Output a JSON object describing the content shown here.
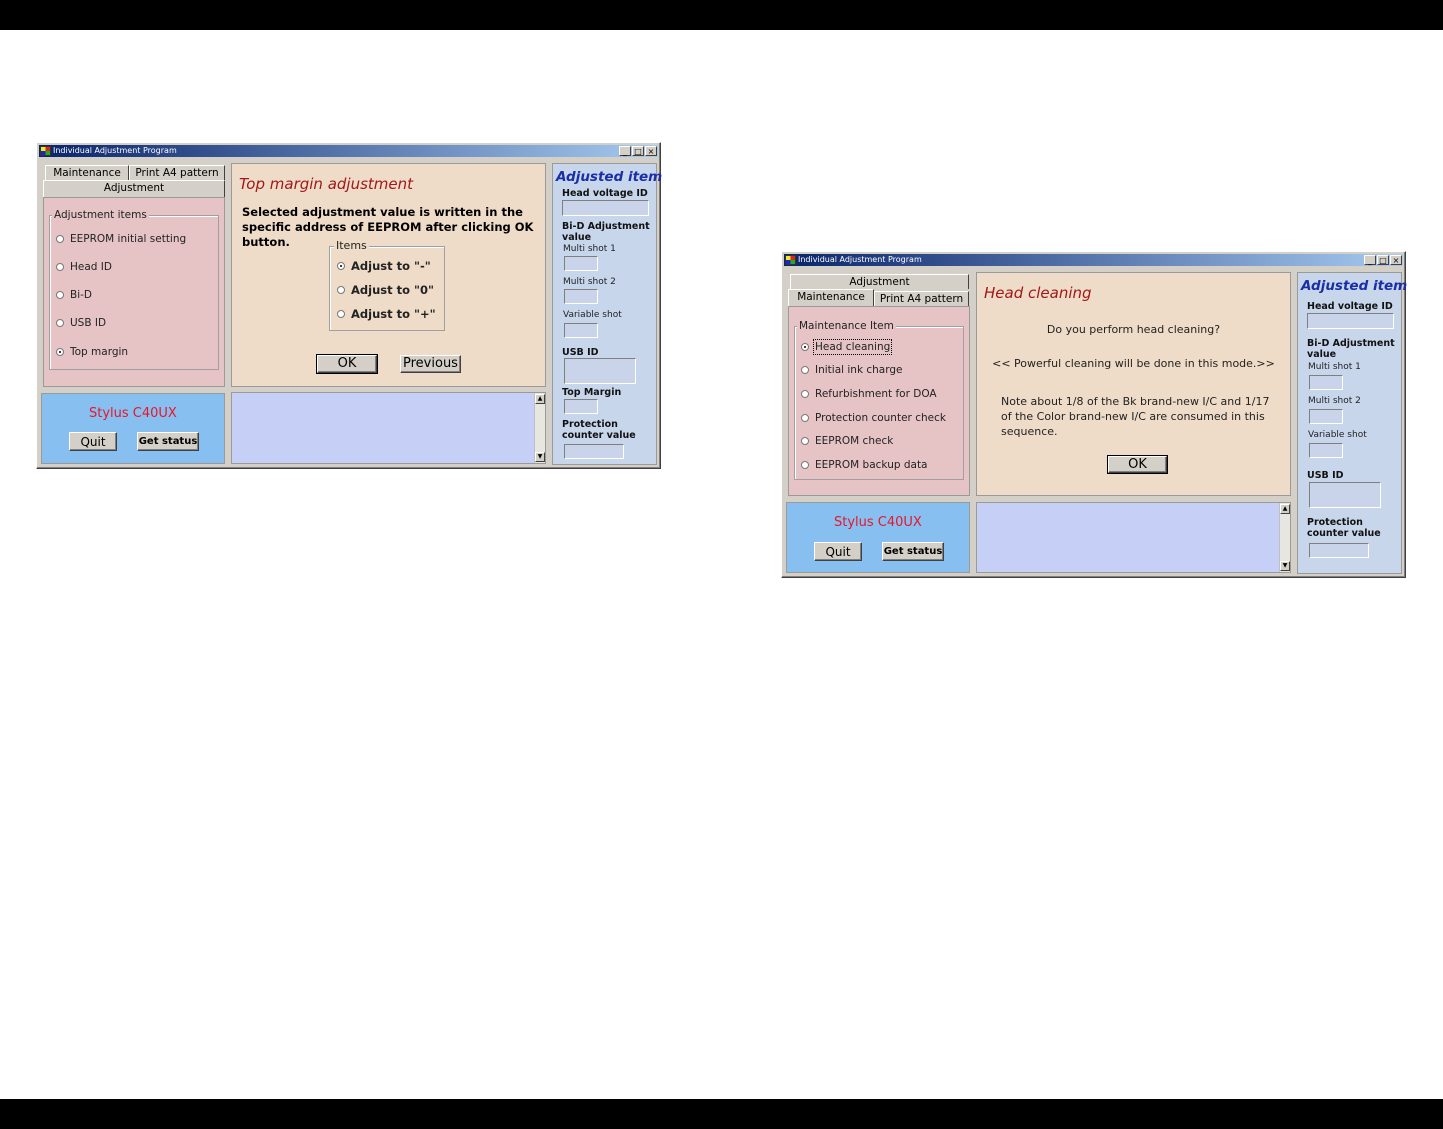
{
  "colors": {
    "page_bar": "#000000",
    "heading_red": "#a01818",
    "model_red": "#e8162a",
    "adjusted_blue": "#1a2ea8"
  },
  "window_left": {
    "title": "Individual Adjustment Program",
    "title_buttons": [
      "_",
      "□",
      "×"
    ],
    "tabs": {
      "maintenance": "Maintenance",
      "print_a4": "Print A4 pattern",
      "adjustment": "Adjustment"
    },
    "group_label": "Adjustment items",
    "items": [
      {
        "label": "EEPROM initial setting",
        "selected": false
      },
      {
        "label": "Head ID",
        "selected": false
      },
      {
        "label": "Bi-D",
        "selected": false
      },
      {
        "label": "USB ID",
        "selected": false
      },
      {
        "label": "Top margin",
        "selected": true
      }
    ],
    "heading": "Top margin adjustment",
    "description": "Selected adjustment value is written in the specific address of EEPROM after clicking OK button.",
    "items_group_label": "Items",
    "adjust_options": [
      {
        "label": "Adjust to \"-\"",
        "selected": true
      },
      {
        "label": "Adjust to \"0\"",
        "selected": false
      },
      {
        "label": "Adjust to \"+\"",
        "selected": false
      }
    ],
    "ok_label": "OK",
    "previous_label": "Previous",
    "model": "Stylus C40UX",
    "quit_label": "Quit",
    "get_status_label": "Get status",
    "adjusted": {
      "title": "Adjusted item",
      "head_voltage": "Head voltage ID",
      "bid": "Bi-D Adjustment value",
      "multi1": "Multi shot 1",
      "multi2": "Multi shot 2",
      "variable": "Variable shot",
      "usb": "USB ID",
      "top_margin": "Top Margin",
      "protection": "Protection counter value"
    }
  },
  "window_right": {
    "title": "Individual Adjustment Program",
    "title_buttons": [
      "_",
      "□",
      "×"
    ],
    "tabs": {
      "adjustment": "Adjustment",
      "maintenance": "Maintenance",
      "print_a4": "Print A4 pattern"
    },
    "group_label": "Maintenance Item",
    "items": [
      {
        "label": "Head cleaning",
        "selected": true
      },
      {
        "label": "Initial ink charge",
        "selected": false
      },
      {
        "label": "Refurbishment for DOA",
        "selected": false
      },
      {
        "label": "Protection counter check",
        "selected": false
      },
      {
        "label": "EEPROM check",
        "selected": false
      },
      {
        "label": "EEPROM backup data",
        "selected": false
      }
    ],
    "heading": "Head cleaning",
    "question": "Do you perform head cleaning?",
    "powerful": "<< Powerful cleaning will be done in this mode.>>",
    "note": "Note about 1/8 of the Bk brand-new I/C and 1/17 of the Color brand-new I/C are consumed in this sequence.",
    "ok_label": "OK",
    "model": "Stylus C40UX",
    "quit_label": "Quit",
    "get_status_label": "Get status",
    "adjusted": {
      "title": "Adjusted item",
      "head_voltage": "Head voltage ID",
      "bid": "Bi-D Adjustment value",
      "multi1": "Multi shot 1",
      "multi2": "Multi shot 2",
      "variable": "Variable shot",
      "usb": "USB ID",
      "protection": "Protection counter value"
    }
  }
}
